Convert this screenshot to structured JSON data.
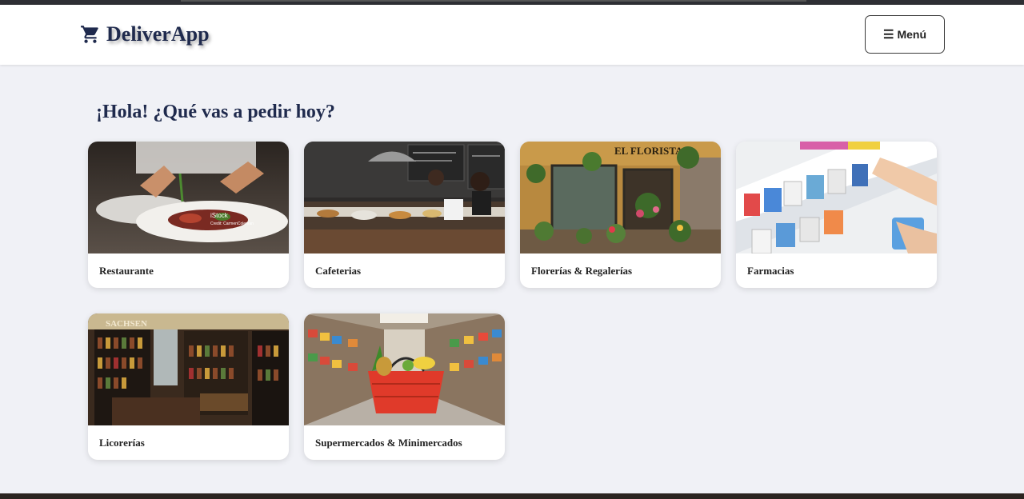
{
  "header": {
    "brand": "DeliverApp",
    "cart_icon": "shopping-cart-icon",
    "menu_label": "Menú",
    "menu_icon": "hamburger-icon"
  },
  "greeting": "¡Hola! ¿Qué vas a pedir hoy?",
  "categories": [
    {
      "label": "Restaurante",
      "image": "chef-plating-dish"
    },
    {
      "label": "Cafeterias",
      "image": "cafe-counter"
    },
    {
      "label": "Florerías & Regalerías",
      "image": "flower-shop-storefront"
    },
    {
      "label": "Farmacias",
      "image": "pharmacy-shelf"
    },
    {
      "label": "Licorerías",
      "image": "liquor-store-shelves"
    },
    {
      "label": "Supermercados & Minimercados",
      "image": "grocery-basket-aisle"
    }
  ],
  "image_text": {
    "restaurante_watermark": "iStock",
    "restaurante_credit": "Credit: CarmenColeman",
    "florist_sign": "EL FLORISTA",
    "licoreria_sign": "SACHSEN"
  },
  "colors": {
    "brand": "#1f2a4d",
    "background": "#f0f1f6"
  }
}
